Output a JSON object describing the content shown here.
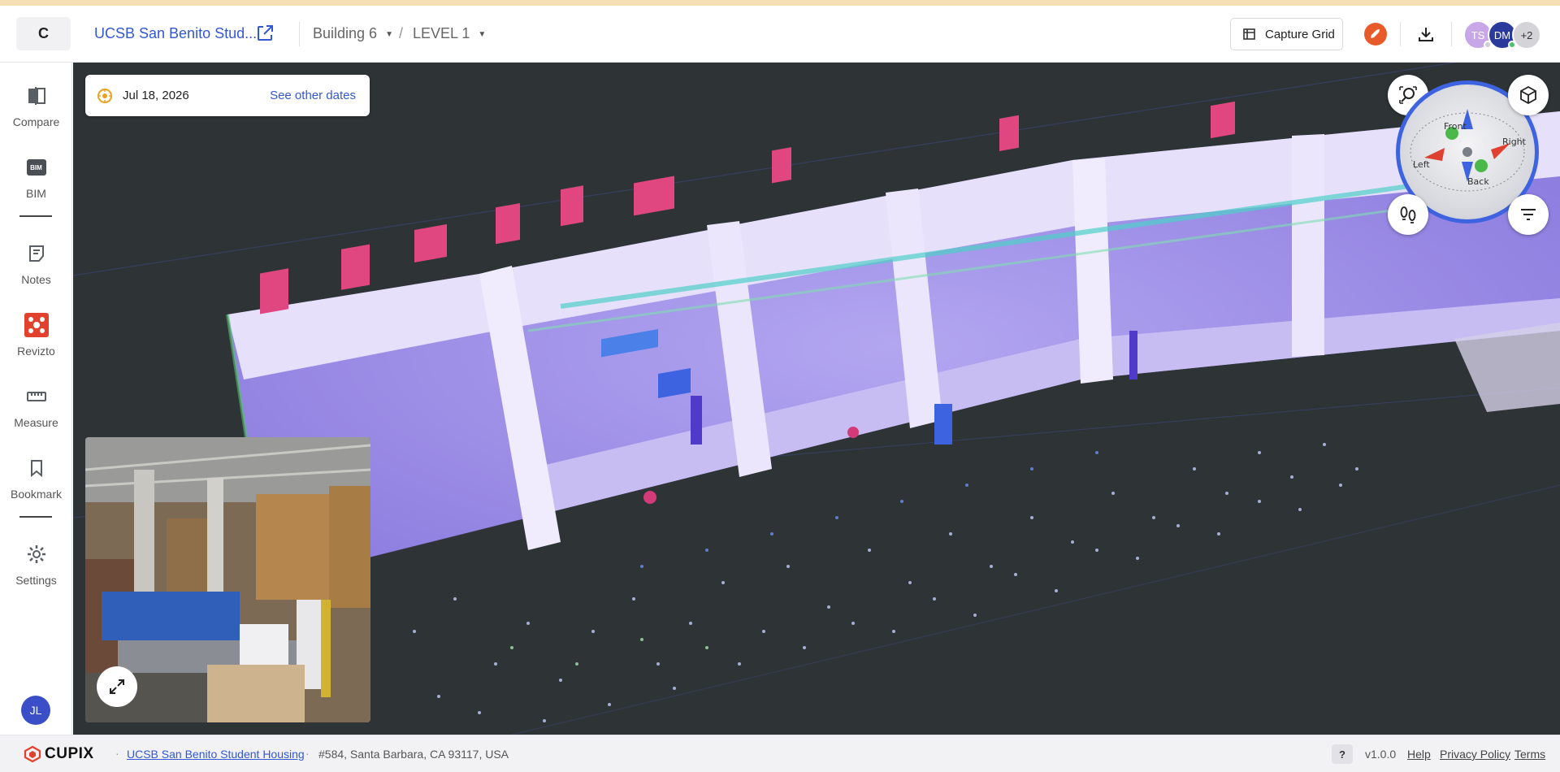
{
  "header": {
    "logo_letter": "C",
    "project_name": "UCSB San Benito Stud...",
    "building": "Building 6",
    "level": "LEVEL 1",
    "capture_grid_label": "Capture Grid",
    "avatars": [
      {
        "initials": "TS",
        "color": "#c8a7e8"
      },
      {
        "initials": "DM",
        "color": "#2a3a9c"
      },
      {
        "initials": "+2",
        "color": "#d3d3d8"
      }
    ]
  },
  "sidebar": {
    "items": [
      {
        "label": "Compare",
        "icon": "compare-icon"
      },
      {
        "label": "BIM",
        "icon": "bim-icon"
      },
      {
        "label": "Notes",
        "icon": "notes-icon"
      },
      {
        "label": "Revizto",
        "icon": "revizto-icon"
      },
      {
        "label": "Measure",
        "icon": "ruler-icon"
      },
      {
        "label": "Bookmark",
        "icon": "bookmark-icon"
      },
      {
        "label": "Settings",
        "icon": "gear-icon"
      }
    ],
    "user_initials": "JL",
    "bim_badge": "BIM"
  },
  "viewer": {
    "date": "Jul 18, 2026",
    "see_other_dates": "See other dates",
    "compass": {
      "front": "Front",
      "back": "Back",
      "left": "Left",
      "right": "Right"
    }
  },
  "footer": {
    "brand": "CUPIX",
    "project_link": "UCSB San Benito Student Housing",
    "address": "#584, Santa Barbara, CA 93117, USA",
    "help_badge": "?",
    "version": "v1.0.0",
    "help": "Help",
    "privacy": "Privacy Policy",
    "terms": "Terms"
  },
  "colors": {
    "accent": "#3358d4",
    "viewer_bg": "#2e3436",
    "compass_ring": "#3d63e0"
  }
}
